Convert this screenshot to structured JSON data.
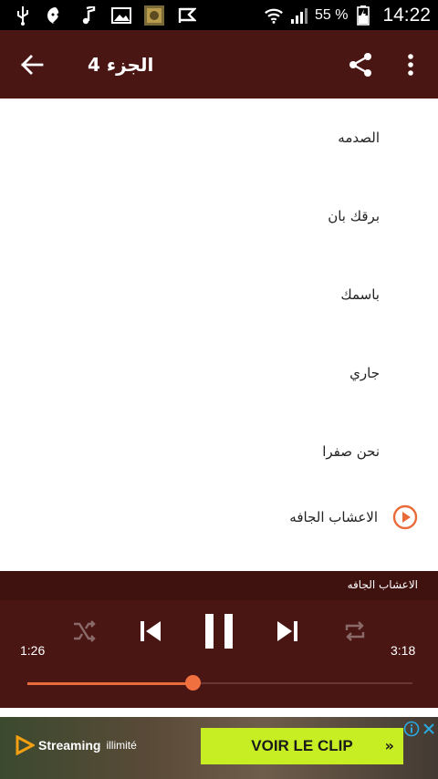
{
  "status_bar": {
    "battery_percent": "55 %",
    "time": "14:22"
  },
  "toolbar": {
    "title": "الجزء 4"
  },
  "tracks": [
    {
      "title": "الصدمه"
    },
    {
      "title": "برقك بان"
    },
    {
      "title": "باسمك"
    },
    {
      "title": "جاري"
    },
    {
      "title": "نحن صفرا"
    },
    {
      "title": "الاعشاب الجافه",
      "playing": true
    }
  ],
  "player": {
    "now_playing": "الاعشاب الجافه",
    "elapsed": "1:26",
    "duration": "3:18",
    "progress": 0.43
  },
  "ad": {
    "brand_name": "Streaming",
    "brand_sub": "illimité",
    "cta_label": "VOIR LE CLIP",
    "cta_chevron": "»"
  },
  "colors": {
    "toolbar": "#4a1614",
    "accent": "#e96b3a"
  }
}
